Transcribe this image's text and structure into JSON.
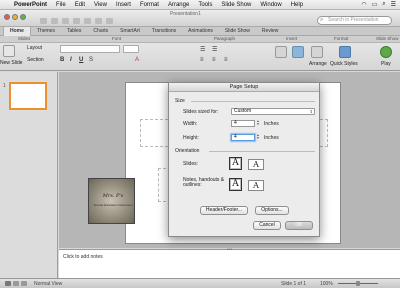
{
  "menubar": {
    "items": [
      "PowerPoint",
      "File",
      "Edit",
      "View",
      "Insert",
      "Format",
      "Arrange",
      "Tools",
      "Slide Show",
      "Window",
      "Help"
    ]
  },
  "window": {
    "title": "Presentation1",
    "search_placeholder": "Search in Presentation"
  },
  "ribbon": {
    "tabs": [
      "Home",
      "Themes",
      "Tables",
      "Charts",
      "SmartArt",
      "Transitions",
      "Animations",
      "Slide Show",
      "Review"
    ],
    "active_tab": "Home",
    "groups": [
      "Slides",
      "Font",
      "Paragraph",
      "Insert",
      "Format",
      "Slide Show"
    ],
    "new_slide_label": "New Slide",
    "layout_label": "Layout",
    "section_label": "Section",
    "arrange_label": "Arrange",
    "quick_styles_label": "Quick Styles",
    "play_label": "Play"
  },
  "thumbnails": {
    "slide_number": "1"
  },
  "slide": {
    "picture_caption": "Mrs. P's",
    "picture_subcaption": "Special Education Classroom"
  },
  "notes": {
    "placeholder": "Click to add notes"
  },
  "statusbar": {
    "view_label": "Normal View",
    "slide_counter": "Slide 1 of 1",
    "zoom": "100%"
  },
  "dialog": {
    "title": "Page Setup",
    "size_section": "Size",
    "slides_sized_for_label": "Slides sized for:",
    "slides_sized_for_value": "Custom",
    "width_label": "Width:",
    "width_value": "4",
    "height_label": "Height:",
    "height_value": "4",
    "unit": "Inches",
    "orientation_section": "Orientation",
    "slides_label": "Slides:",
    "notes_label": "Notes, handouts & outlines:",
    "header_footer_button": "Header/Footer...",
    "options_button": "Options...",
    "cancel_button": "Cancel",
    "ok_button": "OK"
  }
}
